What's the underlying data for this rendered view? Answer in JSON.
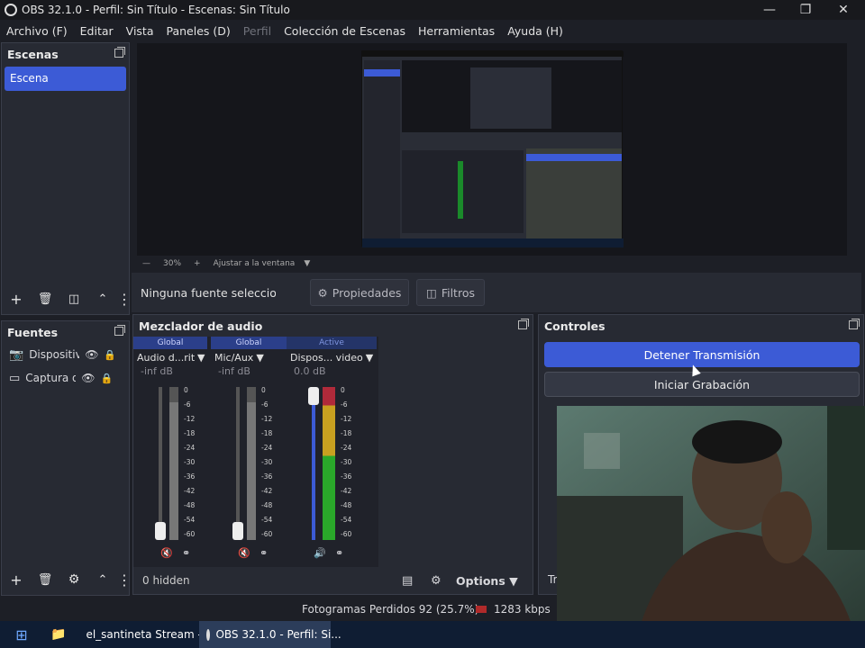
{
  "window": {
    "title": "OBS 32.1.0 - Perfil: Sin Título - Escenas: Sin Título"
  },
  "menu": [
    "Archivo (F)",
    "Editar",
    "Vista",
    "Paneles (D)",
    "Perfil",
    "Colección de Escenas",
    "Herramientas",
    "Ayuda (H)"
  ],
  "scenes": {
    "title": "Escenas",
    "items": [
      "Escena"
    ]
  },
  "sources": {
    "title": "Fuentes",
    "items": [
      "Dispositiv",
      "Captura d"
    ]
  },
  "preview": {
    "zoom": "30%",
    "fit": "Ajustar a la ventana"
  },
  "context": {
    "no_source": "Ninguna fuente seleccionada",
    "properties": "Propiedades",
    "filters": "Filtros"
  },
  "mixer": {
    "title": "Mezclador de audio",
    "channels": [
      {
        "tag": "Global",
        "name": "Audio d...ritorio",
        "db": "-inf dB",
        "level": 0.0,
        "muted": true
      },
      {
        "tag": "Global",
        "name": "Mic/Aux",
        "db": "-inf dB",
        "level": 0.0,
        "muted": true
      },
      {
        "tag": "Active",
        "name": "Dispos... video",
        "db": "0.0 dB",
        "level": 1.0,
        "muted": false
      }
    ],
    "scale": [
      "0",
      "-6",
      "-12",
      "-18",
      "-24",
      "-30",
      "-36",
      "-42",
      "-48",
      "-54",
      "-60"
    ],
    "hidden": "0 hidden",
    "options": "Options"
  },
  "controls": {
    "title": "Controles",
    "stop_stream": "Detener Transmisión",
    "start_record": "Iniciar Grabación",
    "partial": "Tr"
  },
  "status": {
    "dropped": "Fotogramas Perdidos 92 (25.7%)",
    "bitrate": "1283 kbps"
  },
  "taskbar": {
    "items": [
      "el_santineta Stream -...",
      "OBS 32.1.0 - Perfil: Si..."
    ]
  },
  "colors": {
    "accent": "#3c5bd6",
    "panel": "#272a33",
    "bg": "#1d1f26"
  }
}
